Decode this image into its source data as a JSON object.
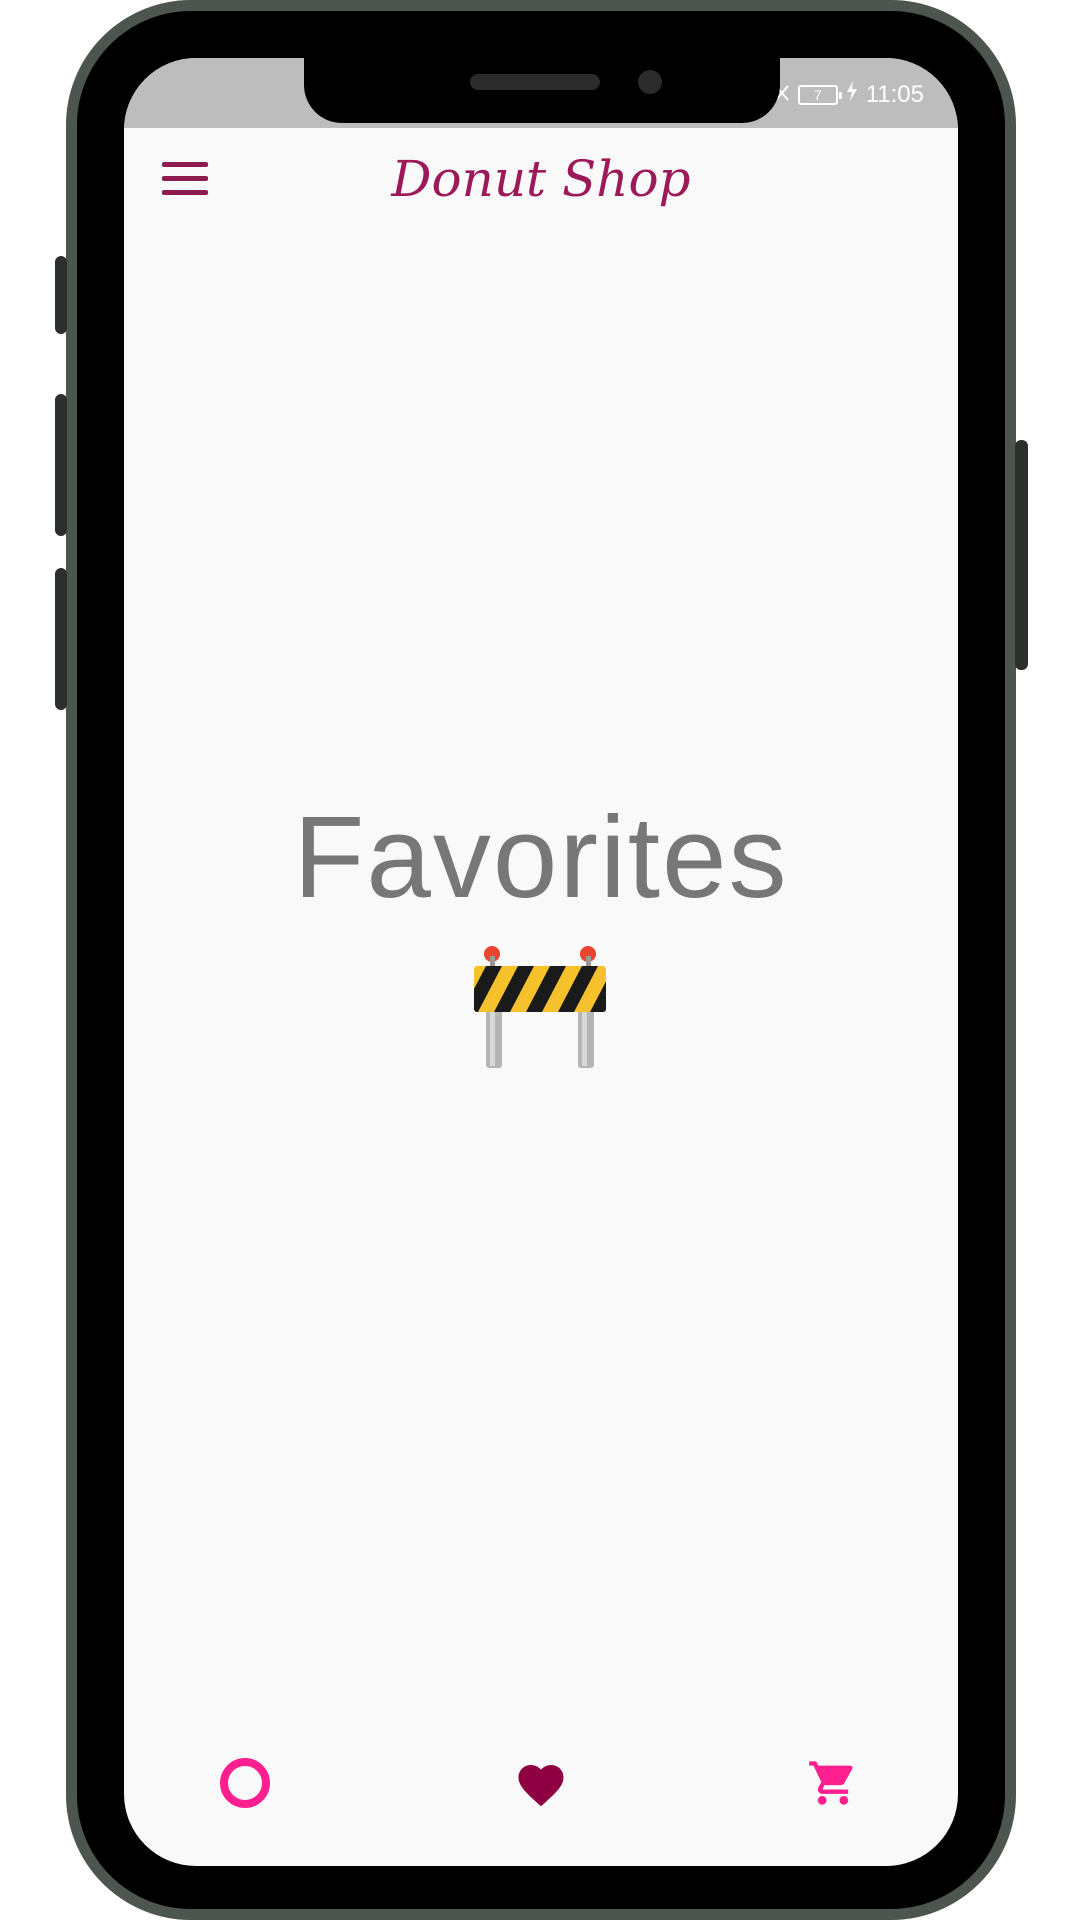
{
  "status_bar": {
    "time": "11:05",
    "battery_level": "7"
  },
  "app_bar": {
    "title": "Donut Shop",
    "menu_icon": "hamburger-menu-icon"
  },
  "main": {
    "title": "Favorites",
    "icon": "construction-barrier-icon"
  },
  "bottom_nav": {
    "items": [
      {
        "icon": "donut-icon",
        "color": "#ff1f8e",
        "active": false
      },
      {
        "icon": "heart-icon",
        "color": "#8e0042",
        "active": true
      },
      {
        "icon": "cart-icon",
        "color": "#ff1f8e",
        "active": false
      }
    ]
  },
  "colors": {
    "brand": "#9c1a5a",
    "accent": "#ff1f8e",
    "background": "#f9f9f9",
    "frame": "#4d554f"
  }
}
